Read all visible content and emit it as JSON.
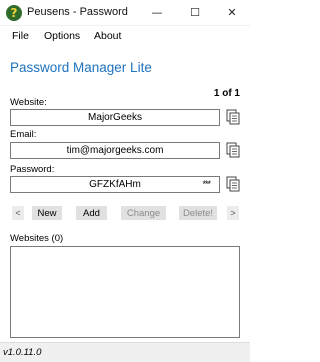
{
  "window": {
    "title": "Peusens - Password Ma...",
    "minimize": "—",
    "maximize": "☐",
    "close": "✕",
    "icon": "app-question-icon"
  },
  "menu": {
    "items": [
      {
        "label": "File"
      },
      {
        "label": "Options"
      },
      {
        "label": "About"
      }
    ]
  },
  "app": {
    "title": "Password Manager Lite",
    "title_color": "#1e73be"
  },
  "record": {
    "counter": "1 of 1"
  },
  "fields": {
    "website_label": "Website:",
    "website_value": "MajorGeeks",
    "email_label": "Email:",
    "email_value": "tim@majorgeeks.com",
    "password_label": "Password:",
    "password_value": "GFZKfAHm",
    "password_toggle": "***"
  },
  "buttons": {
    "prev": "<",
    "new": "New",
    "add": "Add",
    "change": "Change",
    "delete": "Delete!",
    "next": ">"
  },
  "websites": {
    "label": "Websites (0)",
    "items": []
  },
  "status": {
    "version": "v1.0.11.0"
  }
}
